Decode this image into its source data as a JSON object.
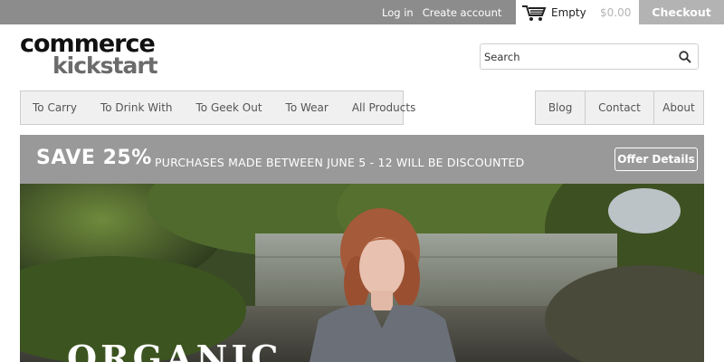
{
  "topbar": {
    "login_label": "Log in",
    "create_account_label": "Create account",
    "cart_label": "Empty",
    "cart_total": "$0.00",
    "checkout_label": "Checkout"
  },
  "logo": {
    "line1": "commerce",
    "line2": "kickstart"
  },
  "search": {
    "placeholder": "Search"
  },
  "nav": {
    "primary": [
      "To Carry",
      "To Drink With",
      "To Geek Out",
      "To Wear",
      "All Products"
    ],
    "secondary": [
      "Blog",
      "Contact",
      "About"
    ]
  },
  "promo": {
    "title": "SAVE 25%",
    "description": "PURCHASES MADE BETWEEN JUNE 5 - 12 WILL BE DISCOUNTED",
    "button_label": "Offer Details"
  },
  "hero": {
    "headline": "ORGANIC"
  },
  "colors": {
    "topbar_bg": "#8c8c8c",
    "checkout_bg": "#b3b3b3",
    "promo_bg": "#999999",
    "nav_bg": "#f0f0f0"
  }
}
